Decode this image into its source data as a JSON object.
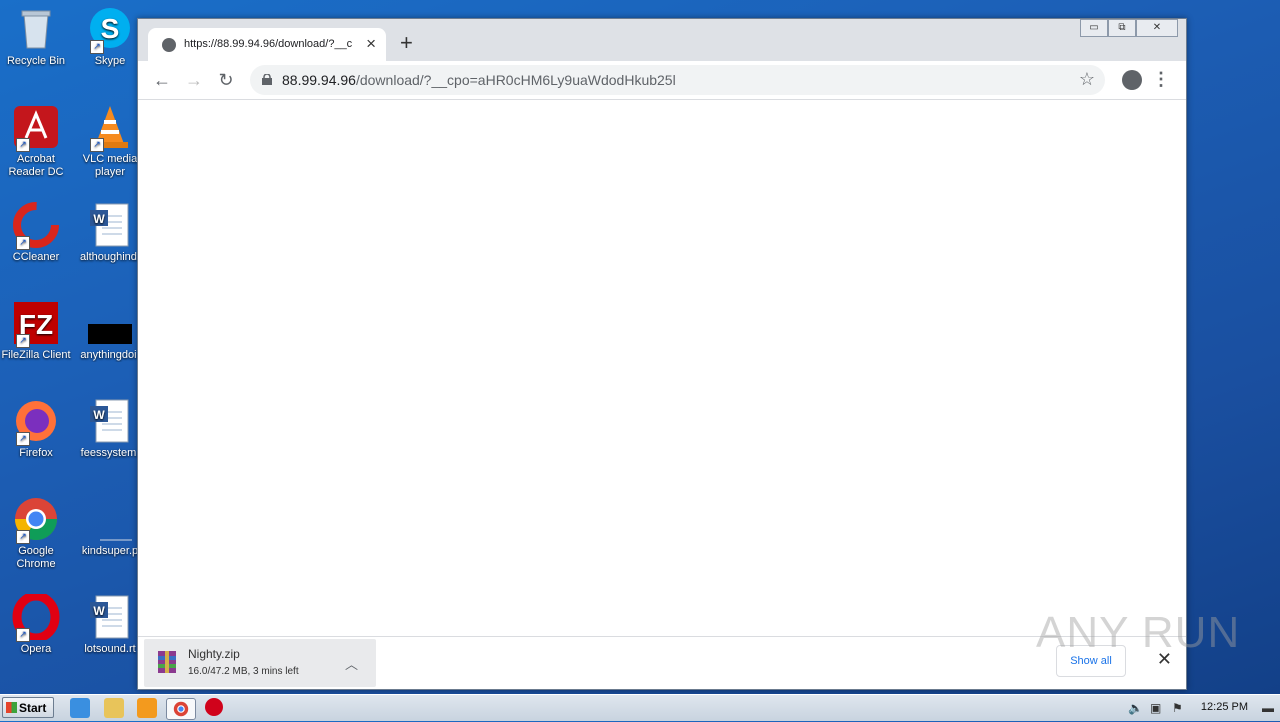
{
  "desktop": {
    "icons": [
      {
        "label": "Recycle Bin",
        "label2": ""
      },
      {
        "label": "Skype",
        "label2": ""
      },
      {
        "label": "Acrobat",
        "label2": "Reader DC"
      },
      {
        "label": "VLC media",
        "label2": "player"
      },
      {
        "label": "CCleaner",
        "label2": ""
      },
      {
        "label": "althoughind.",
        "label2": ""
      },
      {
        "label": "FileZilla Client",
        "label2": ""
      },
      {
        "label": "anythingdoi.",
        "label2": ""
      },
      {
        "label": "Firefox",
        "label2": ""
      },
      {
        "label": "feessystem.",
        "label2": ""
      },
      {
        "label": "Google",
        "label2": "Chrome"
      },
      {
        "label": "kindsuper.p",
        "label2": ""
      },
      {
        "label": "Opera",
        "label2": ""
      },
      {
        "label": "lotsound.rt",
        "label2": ""
      }
    ]
  },
  "browser": {
    "tab_title": "https://88.99.94.96/download/?__c",
    "url_host": "88.99.94.96",
    "url_path": "/download/?__cpo=aHR0cHM6Ly9uaWdodHkub25l",
    "window_buttons": {
      "minimize": "▭",
      "restore": "⧉",
      "close": "✕"
    }
  },
  "download_shelf": {
    "file_name": "Nighty.zip",
    "status": "16.0/47.2 MB, 3 mins left",
    "show_all": "Show all"
  },
  "watermark": "ANY RUN",
  "taskbar": {
    "start_label": "Start",
    "clock": "12:25 PM"
  }
}
